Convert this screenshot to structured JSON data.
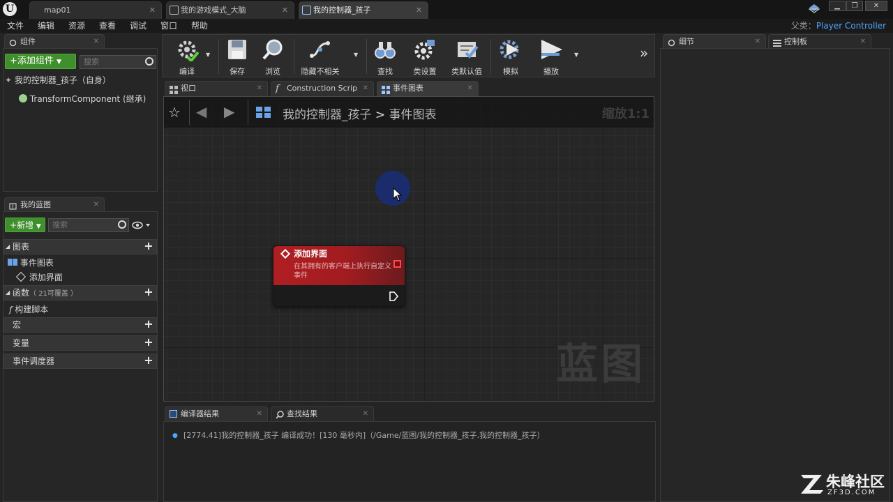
{
  "window": {
    "tabs": [
      {
        "label": "map01",
        "active": false
      },
      {
        "label": "我的游戏模式_大脑",
        "active": false
      },
      {
        "label": "我的控制器_孩子",
        "active": true
      }
    ]
  },
  "menu": {
    "items": [
      "文件",
      "编辑",
      "资源",
      "查看",
      "调试",
      "窗口",
      "帮助"
    ],
    "parent_class_label": "父类：",
    "parent_class_value": "Player Controller"
  },
  "components_panel": {
    "tab_label": "组件",
    "add_button": "添加组件",
    "search_placeholder": "搜索",
    "root_item": "我的控制器_孩子（自身）",
    "child_item": "TransformComponent (继承)"
  },
  "my_blueprint_panel": {
    "tab_label": "我的蓝图",
    "new_button": "新增",
    "search_placeholder": "搜索",
    "sections": {
      "graphs": "图表",
      "event_graph": "事件图表",
      "event_item": "添加界面",
      "functions": "函数",
      "functions_note": "（ 21可覆盖 ）",
      "construction": "构建脚本",
      "macros": "宏",
      "variables": "变量",
      "dispatchers": "事件调度器"
    }
  },
  "toolbar": {
    "compile": "编译",
    "save": "保存",
    "browse": "浏览",
    "hide_unrelated": "隐藏不相关",
    "find": "查找",
    "class_settings": "类设置",
    "class_defaults": "类默认值",
    "simulate": "模拟",
    "play": "播放"
  },
  "editor_tabs": {
    "viewport": "视口",
    "construction": "Construction Scrip",
    "event_graph": "事件图表"
  },
  "graph": {
    "breadcrumb_root": "我的控制器_孩子",
    "breadcrumb_sep": ">",
    "breadcrumb_leaf": "事件图表",
    "zoom": "缩放1:1",
    "watermark": "蓝图",
    "node": {
      "title": "添加界面",
      "description": "在其拥有的客户端上执行自定义事件"
    }
  },
  "bottom_panel": {
    "tabs": [
      "编译器结果",
      "查找结果"
    ],
    "log": "[2774.41]我的控制器_孩子 编译成功！[130 毫秒内]（/Game/蓝图/我的控制器_孩子.我的控制器_孩子）"
  },
  "right_panel": {
    "details_tab": "细节",
    "palette_tab": "控制板"
  },
  "site_watermark": {
    "name": "朱峰社区",
    "url": "ZF3D.COM"
  },
  "colors": {
    "accent_blue": "#4ea5ff",
    "green_button": "#3f8f2c",
    "event_node_red": "#b01e22",
    "pin_red": "#e04040"
  }
}
